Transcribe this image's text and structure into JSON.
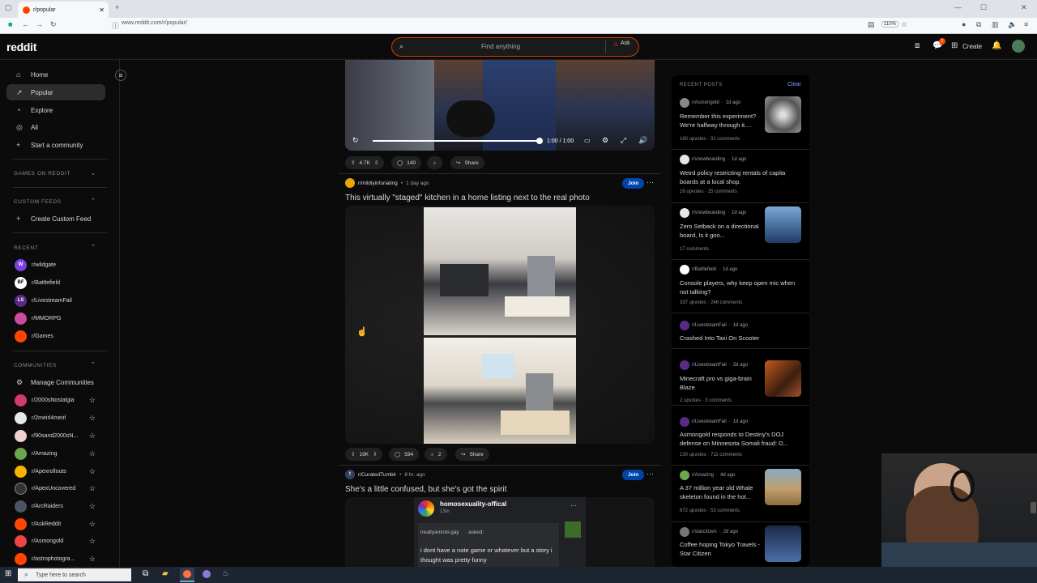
{
  "browser": {
    "tab_title": "r/popular",
    "url": "www.reddit.com/r/popular/",
    "zoom": "110%"
  },
  "header": {
    "logo": "reddit",
    "search_placeholder": "Find anything",
    "ask_label": "Ask",
    "create_label": "Create",
    "chat_badge": "1"
  },
  "sidebar": {
    "nav": [
      {
        "label": "Home",
        "icon": "home-icon"
      },
      {
        "label": "Popular",
        "icon": "popular-icon"
      },
      {
        "label": "Explore",
        "icon": "explore-icon"
      },
      {
        "label": "All",
        "icon": "all-icon"
      },
      {
        "label": "Start a community",
        "icon": "plus-icon"
      }
    ],
    "games_heading": "GAMES ON REDDIT",
    "custom_feeds_heading": "CUSTOM FEEDS",
    "create_custom_feed": "Create Custom Feed",
    "recent_heading": "RECENT",
    "recent": [
      {
        "name": "r/wildgate",
        "color": "#7b3fe4",
        "glyph": "W"
      },
      {
        "name": "r/Battlefield",
        "color": "#ffffff",
        "glyph": "BF"
      },
      {
        "name": "r/LivestreamFail",
        "color": "#5b2a86",
        "glyph": "LS"
      },
      {
        "name": "r/MMORPG",
        "color": "#c94d9b",
        "glyph": ""
      },
      {
        "name": "r/Games",
        "color": "#ff4500",
        "glyph": ""
      }
    ],
    "communities_heading": "COMMUNITIES",
    "manage_communities": "Manage Communities",
    "communities": [
      {
        "name": "r/2000sNostalgia",
        "color": "#d23a6a"
      },
      {
        "name": "r/2meirl4meirl",
        "color": "#e8e8e8"
      },
      {
        "name": "r/90sand2000sN...",
        "color": "#f2d0d0"
      },
      {
        "name": "r/Amazing",
        "color": "#6aa84f"
      },
      {
        "name": "r/Apexrollouts",
        "color": "#f5b400"
      },
      {
        "name": "r/ApexUncovered",
        "color": "#333333"
      },
      {
        "name": "r/ArcRaiders",
        "color": "#4b5563"
      },
      {
        "name": "r/AskReddit",
        "color": "#ff4500"
      },
      {
        "name": "r/Asmongold",
        "color": "#ef4444"
      },
      {
        "name": "r/astrophotogra...",
        "color": "#ff4500"
      }
    ]
  },
  "feed": {
    "video_post": {
      "time": "1:00 / 1:00",
      "upvotes": "4.7K",
      "comments": "140",
      "share": "Share"
    },
    "post2": {
      "subreddit": "r/mildlyinfuriating",
      "age": "1 day ago",
      "join": "Join",
      "title": "This virtually \"staged\" kitchen in a home listing next to the real photo",
      "upvotes": "19K",
      "comments": "594",
      "awards": "2",
      "share": "Share"
    },
    "post3": {
      "subreddit": "r/CuratedTumblr",
      "age": "8 hr. ago",
      "join": "Join",
      "title": "She's a little confused, but she's got the spirit",
      "tumblr_user": "homosexuality-offical",
      "tumblr_time": "13m",
      "asker": "ireallyamnot-gay",
      "asked": "asked:",
      "question": "i dont have a note game or whatever but a story i thought was pretty funny"
    }
  },
  "recent_posts": {
    "heading": "RECENT POSTS",
    "clear": "Clear",
    "items": [
      {
        "sub": "r/Asmongold",
        "age": "1d ago",
        "title": "Remember this experiment? We're halfway through it....",
        "stats": "160 upvotes · 31 comments",
        "thumb": "#8c8c8c",
        "av": "#888"
      },
      {
        "sub": "r/snowboarding",
        "age": "1d ago",
        "title": "Weird policy restricting rentals of capita boards at a local shop.",
        "stats": "16 upvotes · 25 comments",
        "thumb": "",
        "av": "#e5e5e5"
      },
      {
        "sub": "r/snowboarding",
        "age": "1d ago",
        "title": "Zero Setback on a directional board, Is it goo...",
        "stats": "17 comments",
        "thumb": "#3b6ea8",
        "av": "#e5e5e5"
      },
      {
        "sub": "r/Battlefield",
        "age": "1d ago",
        "title": "Console players, why keep open mic when not talking?",
        "stats": "337 upvotes · 246 comments",
        "thumb": "",
        "av": "#ffffff"
      },
      {
        "sub": "r/LivestreamFail",
        "age": "1d ago",
        "title": "Crashed Into Taxi On Scooter",
        "stats": "",
        "thumb": "",
        "av": "#5b2a86"
      },
      {
        "sub": "r/LivestreamFail",
        "age": "2d ago",
        "title": "Minecraft pro vs giga-brain Blaze",
        "stats": "2 upvotes · 3 comments",
        "thumb": "#a0522d",
        "av": "#5b2a86"
      },
      {
        "sub": "r/LivestreamFail",
        "age": "1d ago",
        "title": "Asmongold responds to Destiny's DOJ defense on Minnesota Somali fraud: D...",
        "stats": "130 upvotes · 711 comments",
        "thumb": "",
        "av": "#5b2a86"
      },
      {
        "sub": "r/Amazing",
        "age": "4d ago",
        "title": "A 37 million year old Whale skeleton found in the hot...",
        "stats": "672 upvotes · 53 comments",
        "thumb": "#c2a06b",
        "av": "#6aa84f"
      },
      {
        "sub": "r/starcitizen",
        "age": "2d ago",
        "title": "Coffee hoping Tokyo Travels - Star Citizen",
        "stats": "",
        "thumb": "#2d4a7a",
        "av": "#777"
      }
    ]
  },
  "taskbar": {
    "search_placeholder": "Type here to search"
  }
}
